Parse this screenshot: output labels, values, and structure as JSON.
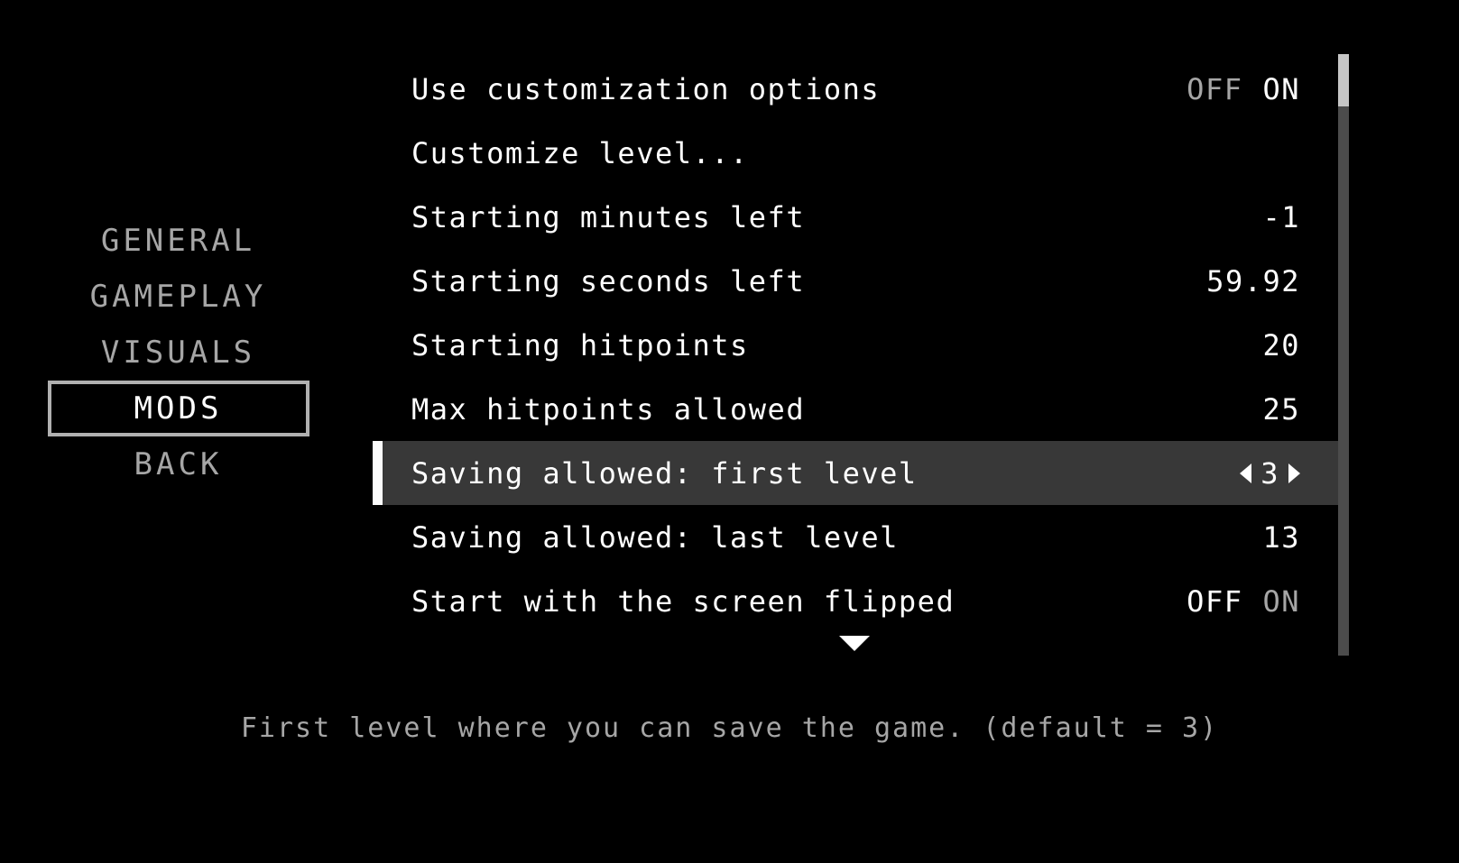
{
  "sidebar": {
    "items": [
      {
        "label": "GENERAL",
        "selected": false
      },
      {
        "label": "GAMEPLAY",
        "selected": false
      },
      {
        "label": "VISUALS",
        "selected": false
      },
      {
        "label": "MODS",
        "selected": true
      },
      {
        "label": "BACK",
        "selected": false
      }
    ]
  },
  "options": {
    "rows": [
      {
        "label": "Use customization options",
        "type": "toggle",
        "off_label": "OFF",
        "on_label": "ON",
        "value": "ON",
        "selected": false
      },
      {
        "label": "Customize level...",
        "type": "action",
        "value": "",
        "selected": false
      },
      {
        "label": "Starting minutes left",
        "type": "number",
        "value": "-1",
        "selected": false
      },
      {
        "label": "Starting seconds left",
        "type": "number",
        "value": "59.92",
        "selected": false
      },
      {
        "label": "Starting hitpoints",
        "type": "number",
        "value": "20",
        "selected": false
      },
      {
        "label": "Max hitpoints allowed",
        "type": "number",
        "value": "25",
        "selected": false
      },
      {
        "label": "Saving allowed: first level",
        "type": "stepper",
        "value": "3",
        "left_arrow": "◀",
        "right_arrow": "▶",
        "selected": true
      },
      {
        "label": "Saving allowed: last level",
        "type": "number",
        "value": "13",
        "selected": false
      },
      {
        "label": "Start with the screen flipped",
        "type": "toggle",
        "off_label": "OFF",
        "on_label": "ON",
        "value": "OFF",
        "selected": false
      }
    ]
  },
  "scrollbar": {
    "thumb_top_pct": 0,
    "thumb_height_pct": 8.7
  },
  "more_indicator": "▼",
  "description": "First level where you can save the game. (default = 3)",
  "colors": {
    "background": "#000000",
    "text_active": "#ffffff",
    "text_dim": "#a6a6a6",
    "row_selected_bg": "#383838",
    "selection_bar": "#fbfbfb",
    "scroll_track": "#4c4c4c",
    "scroll_thumb": "#c6c6c6"
  }
}
